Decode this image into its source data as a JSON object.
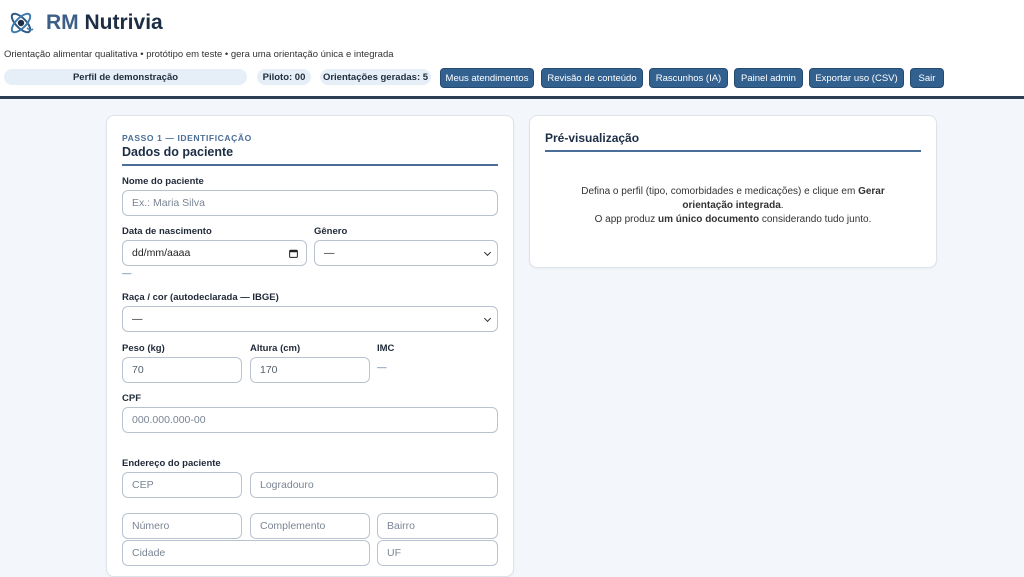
{
  "header": {
    "brand_prefix": "RM",
    "brand_name": "Nutrivia",
    "tagline": "Orientação alimentar qualitativa • protótipo em teste • gera uma orientação única e integrada",
    "profile": "Perfil de demonstração",
    "pilot_chip": "Piloto: 00",
    "generated_chip": "Orientações geradas: 5",
    "buttons": {
      "attendances": "Meus atendimentos",
      "content_review": "Revisão de conteúdo",
      "drafts": "Rascunhos (IA)",
      "admin": "Painel admin",
      "export": "Exportar uso (CSV)",
      "logout": "Sair"
    }
  },
  "form": {
    "step": "PASSO 1 — IDENTIFICAÇÃO",
    "title": "Dados do paciente",
    "name_label": "Nome do paciente",
    "name_placeholder": "Ex.: Maria Silva",
    "birth_label": "Data de nascimento",
    "birth_placeholder": "dd/mm/aaaa",
    "gender_label": "Gênero",
    "gender_value": "—",
    "age_value": "—",
    "race_label": "Raça / cor (autodeclarada — IBGE)",
    "race_value": "—",
    "weight_label": "Peso (kg)",
    "weight_value": "70",
    "height_label": "Altura (cm)",
    "height_value": "170",
    "bmi_label": "IMC",
    "bmi_value": "—",
    "cpf_label": "CPF",
    "cpf_placeholder": "000.000.000-00",
    "address_label": "Endereço do paciente",
    "cep_placeholder": "CEP",
    "street_placeholder": "Logradouro",
    "number_placeholder": "Número",
    "complement_placeholder": "Complemento",
    "district_placeholder": "Bairro",
    "city_placeholder": "Cidade",
    "state_placeholder": "UF"
  },
  "preview": {
    "title": "Pré-visualização",
    "line1_a": "Defina o perfil (tipo, comorbidades e medicações) e clique em ",
    "line1_b": "Gerar orientação integrada",
    "line1_c": ".",
    "line2_a": "O app produz ",
    "line2_b": "um único documento",
    "line2_c": " considerando tudo junto."
  },
  "colors": {
    "primary": "#33618f",
    "accent": "#4a6e97",
    "header_border": "#2e3e55",
    "background": "#f3f6fa"
  }
}
